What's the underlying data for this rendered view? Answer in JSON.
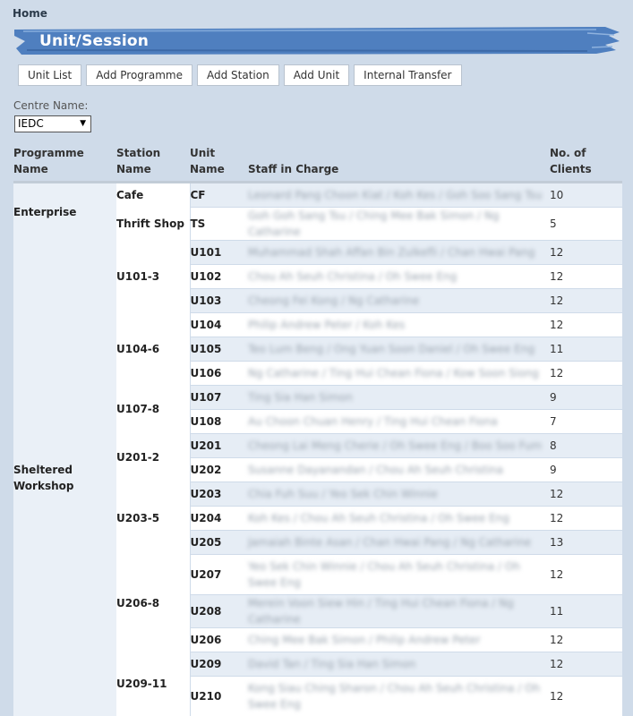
{
  "breadcrumb": "Home",
  "page_title": "Unit/Session",
  "actions": [
    "Unit List",
    "Add Programme",
    "Add Station",
    "Add Unit",
    "Internal Transfer"
  ],
  "centre": {
    "label": "Centre Name:",
    "selected": "IEDC"
  },
  "table": {
    "headers": {
      "programme": "Programme Name",
      "station": "Station Name",
      "unit": "Unit Name",
      "staff": "Staff in Charge",
      "clients": "No. of Clients"
    },
    "rows": [
      {
        "programme": "Enterprise",
        "station": "Cafe",
        "unit": "CF",
        "staff": "Leonard Pang Choon Kiat / Koh Kes / Goh Soo Sang Tsu",
        "clients": "10"
      },
      {
        "programme": "Enterprise",
        "station": "Thrift Shop",
        "unit": "TS",
        "staff": "Goh Goh Sang Tsu / Ching Mee Bak Simon / Ng Catharine",
        "clients": "5"
      },
      {
        "programme": "Sheltered Workshop",
        "station": "U101-3",
        "unit": "U101",
        "staff": "Muhammad Shah Affan Bin Zulkefli / Chan Hwai Pang",
        "clients": "12"
      },
      {
        "programme": "Sheltered Workshop",
        "station": "U101-3",
        "unit": "U102",
        "staff": "Chou Ah Seuh Christina / Oh Swee Eng",
        "clients": "12"
      },
      {
        "programme": "Sheltered Workshop",
        "station": "U101-3",
        "unit": "U103",
        "staff": "Cheong Fei Kong / Ng Catharine",
        "clients": "12"
      },
      {
        "programme": "Sheltered Workshop",
        "station": "U104-6",
        "unit": "U104",
        "staff": "Philip Andrew Peter / Koh Kes",
        "clients": "12"
      },
      {
        "programme": "Sheltered Workshop",
        "station": "U104-6",
        "unit": "U105",
        "staff": "Teo Lum Beng / Ong Yuan Soon Daniel / Oh Swee Eng",
        "clients": "11"
      },
      {
        "programme": "Sheltered Workshop",
        "station": "U104-6",
        "unit": "U106",
        "staff": "Ng Catharine / Ting Hui Chean Fiona / Kow Soon Siong",
        "clients": "12"
      },
      {
        "programme": "Sheltered Workshop",
        "station": "U107-8",
        "unit": "U107",
        "staff": "Ting Sia Han Simon",
        "clients": "9"
      },
      {
        "programme": "Sheltered Workshop",
        "station": "U107-8",
        "unit": "U108",
        "staff": "Au Choon Chuan Henry / Ting Hui Chean Fiona",
        "clients": "7"
      },
      {
        "programme": "Sheltered Workshop",
        "station": "U201-2",
        "unit": "U201",
        "staff": "Cheong Lai Meng Cherie / Oh Swee Eng / Boo Soo Fum",
        "clients": "8"
      },
      {
        "programme": "Sheltered Workshop",
        "station": "U201-2",
        "unit": "U202",
        "staff": "Susanne Dayanandan / Chou Ah Seuh Christina",
        "clients": "9"
      },
      {
        "programme": "Sheltered Workshop",
        "station": "U203-5",
        "unit": "U203",
        "staff": "Chia Fuh Suu / Yeo Sek Chin Winnie",
        "clients": "12"
      },
      {
        "programme": "Sheltered Workshop",
        "station": "U203-5",
        "unit": "U204",
        "staff": "Koh Kes / Chou Ah Seuh Christina / Oh Swee Eng",
        "clients": "12"
      },
      {
        "programme": "Sheltered Workshop",
        "station": "U203-5",
        "unit": "U205",
        "staff": "Jamaiah Binte Asan / Chan Hwai Pang / Ng Catharine",
        "clients": "13"
      },
      {
        "programme": "Sheltered Workshop",
        "station": "U206-8",
        "unit": "U207",
        "staff": "Yeo Sek Chin Winnie / Chou Ah Seuh Christina / Oh Swee Eng",
        "clients": "12"
      },
      {
        "programme": "Sheltered Workshop",
        "station": "U206-8",
        "unit": "U208",
        "staff": "Merein Voon Siew Hin / Ting Hui Chean Fiona / Ng Catharine",
        "clients": "11"
      },
      {
        "programme": "Sheltered Workshop",
        "station": "U206-8",
        "unit": "U206",
        "staff": "Ching Mee Bak Simon / Philip Andrew Peter",
        "clients": "12"
      },
      {
        "programme": "Sheltered Workshop",
        "station": "U209-11",
        "unit": "U209",
        "staff": "David Tan / Ting Sia Han Simon",
        "clients": "12"
      },
      {
        "programme": "Sheltered Workshop",
        "station": "U209-11",
        "unit": "U210",
        "staff": "Kong Siau Ching Sharon / Chou Ah Seuh Christina / Oh Swee Eng",
        "clients": "12"
      }
    ]
  }
}
